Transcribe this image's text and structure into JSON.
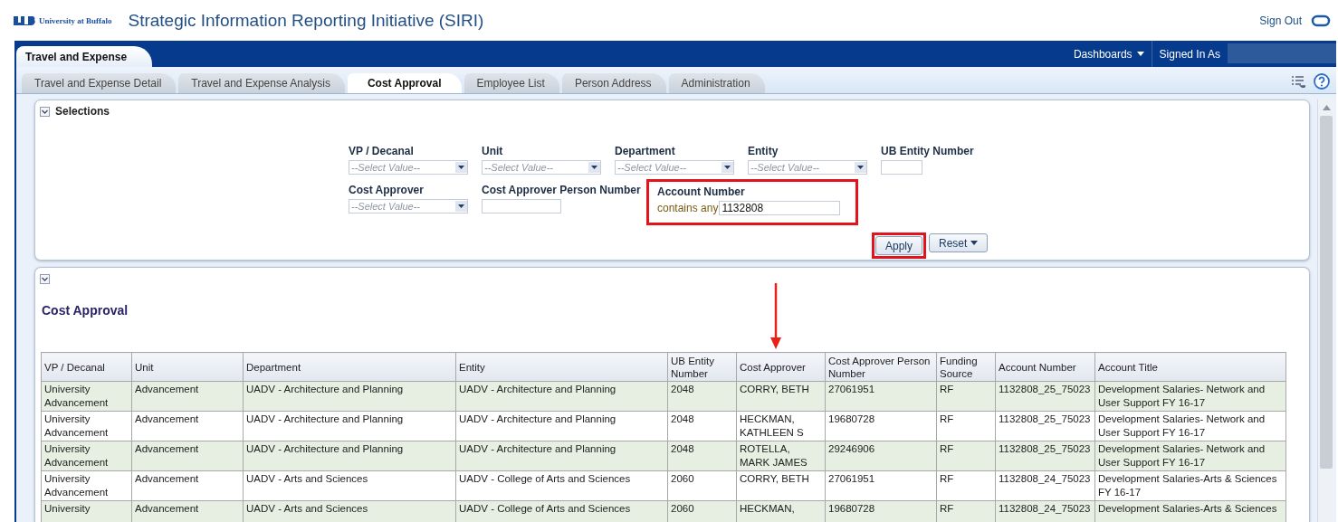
{
  "header": {
    "logo_text": "University at Buffalo",
    "title": "Strategic Information Reporting Initiative (SIRI)",
    "sign_out": "Sign Out"
  },
  "dashboard_tab": {
    "label": "Travel and Expense"
  },
  "top_links": [
    {
      "label": "Dashboards",
      "dropdown": true
    },
    {
      "label": "Signed In As",
      "dropdown": false
    }
  ],
  "tabs": [
    {
      "label": "Travel and Expense Detail",
      "selected": false
    },
    {
      "label": "Travel and Expense Analysis",
      "selected": false
    },
    {
      "label": "Cost Approval",
      "selected": true
    },
    {
      "label": "Employee List",
      "selected": false
    },
    {
      "label": "Person Address",
      "selected": false
    },
    {
      "label": "Administration",
      "selected": false
    }
  ],
  "selections": {
    "title": "Selections",
    "expanded": true,
    "rows": [
      [
        {
          "kind": "select",
          "label": "VP / Decanal",
          "placeholder": "--Select Value--",
          "highlighted": false
        },
        {
          "kind": "select",
          "label": "Unit",
          "placeholder": "--Select Value--",
          "highlighted": false
        },
        {
          "kind": "select",
          "label": "Department",
          "placeholder": "--Select Value--",
          "highlighted": false
        },
        {
          "kind": "select",
          "label": "Entity",
          "placeholder": "--Select Value--",
          "highlighted": false
        },
        {
          "kind": "text",
          "label": "UB Entity Number",
          "highlighted": false
        }
      ],
      [
        {
          "kind": "select",
          "label": "Cost Approver",
          "placeholder": "--Select Value--",
          "highlighted": false
        },
        {
          "kind": "text",
          "label": "Cost Approver Person Number",
          "highlighted": false
        },
        {
          "kind": "contains",
          "label": "Account Number",
          "operator": "contains any",
          "value": "1132808",
          "highlighted": true
        }
      ]
    ],
    "buttons": [
      {
        "label": "Apply",
        "dropdown": false,
        "highlighted": true
      },
      {
        "label": "Reset",
        "dropdown": true,
        "highlighted": false
      }
    ]
  },
  "report": {
    "title": "Cost Approval",
    "columns": [
      {
        "label": "VP / Decanal",
        "pointed": false
      },
      {
        "label": "Unit",
        "pointed": false
      },
      {
        "label": "Department",
        "pointed": false
      },
      {
        "label": "Entity",
        "pointed": false
      },
      {
        "label": "UB Entity Number",
        "pointed": false
      },
      {
        "label": "Cost Approver",
        "pointed": true
      },
      {
        "label": "Cost Approver Person Number",
        "pointed": false
      },
      {
        "label": "Funding Source",
        "pointed": false
      },
      {
        "label": "Account Number",
        "pointed": false
      },
      {
        "label": "Account Title",
        "pointed": false
      }
    ],
    "rows": [
      [
        "University Advancement",
        "Advancement",
        "UADV - Architecture and Planning",
        "UADV - Architecture and Planning",
        "2048",
        "CORRY, BETH",
        "27061951",
        "RF",
        "1132808_25_75023",
        "Development Salaries- Network and User Support FY 16-17"
      ],
      [
        "University Advancement",
        "Advancement",
        "UADV - Architecture and Planning",
        "UADV - Architecture and Planning",
        "2048",
        "HECKMAN, KATHLEEN S",
        "19680728",
        "RF",
        "1132808_25_75023",
        "Development Salaries- Network and User Support FY 16-17"
      ],
      [
        "University Advancement",
        "Advancement",
        "UADV - Architecture and Planning",
        "UADV - Architecture and Planning",
        "2048",
        "ROTELLA, MARK JAMES",
        "29246906",
        "RF",
        "1132808_25_75023",
        "Development Salaries- Network and User Support FY 16-17"
      ],
      [
        "University Advancement",
        "Advancement",
        "UADV - Arts and Sciences",
        "UADV - College of Arts and Sciences",
        "2060",
        "CORRY, BETH",
        "27061951",
        "RF",
        "1132808_24_75023",
        "Development Salaries-Arts & Sciences FY 16-17"
      ],
      [
        "University",
        "Advancement",
        "UADV - Arts and Sciences",
        "UADV - College of Arts and Sciences",
        "2060",
        "HECKMAN,",
        "19680728",
        "RF",
        "1132808_24_75023",
        "Development Salaries-Arts & Sciences"
      ]
    ]
  }
}
